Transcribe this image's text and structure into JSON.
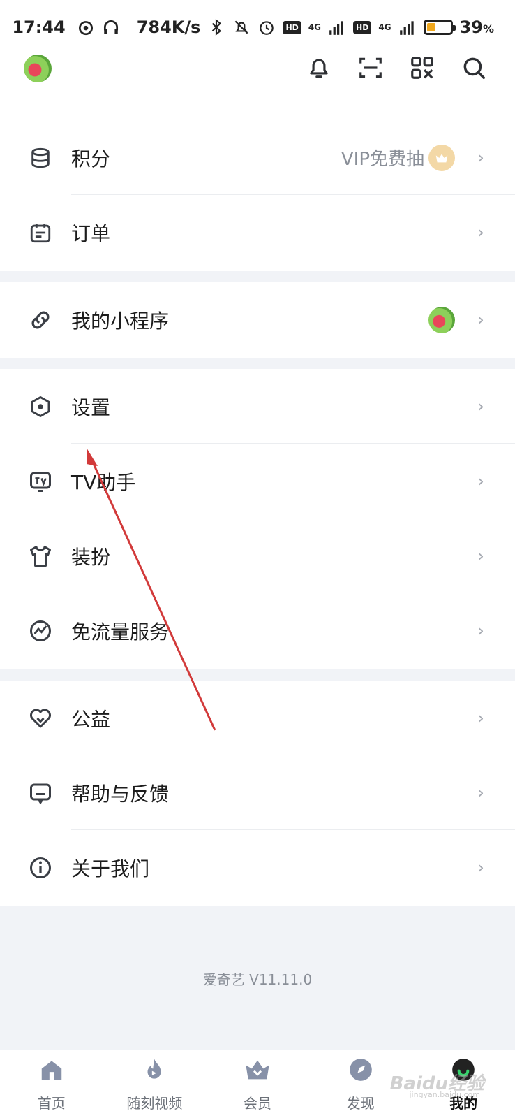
{
  "status_bar": {
    "time": "17:44",
    "speed": "784K/s",
    "battery": "39",
    "battery_unit": "%",
    "hd1": "HD",
    "hd2": "HD",
    "sig1": "4G",
    "sig2": "4G"
  },
  "header": {
    "icons": [
      "bell-icon",
      "scan-icon",
      "qrcode-icon",
      "search-icon"
    ]
  },
  "menu_groups": [
    {
      "items": [
        {
          "label": "积分",
          "icon": "coins-icon",
          "extra": "VIP免费抽"
        },
        {
          "label": "订单",
          "icon": "order-icon"
        }
      ]
    },
    {
      "items": [
        {
          "label": "我的小程序",
          "icon": "link-icon"
        }
      ]
    },
    {
      "items": [
        {
          "label": "设置",
          "icon": "settings-icon"
        },
        {
          "label": "TV助手",
          "icon": "tv-icon"
        },
        {
          "label": "装扮",
          "icon": "shirt-icon"
        },
        {
          "label": "免流量服务",
          "icon": "data-icon"
        }
      ]
    },
    {
      "items": [
        {
          "label": "公益",
          "icon": "heart-icon"
        },
        {
          "label": "帮助与反馈",
          "icon": "feedback-icon"
        },
        {
          "label": "关于我们",
          "icon": "info-icon"
        }
      ]
    }
  ],
  "version": "爱奇艺 V11.11.0",
  "bottom_nav": [
    {
      "label": "首页",
      "icon": "home-icon"
    },
    {
      "label": "随刻视频",
      "icon": "flame-icon"
    },
    {
      "label": "会员",
      "icon": "crown-icon"
    },
    {
      "label": "发现",
      "icon": "compass-icon"
    },
    {
      "label": "我的",
      "icon": "profile-icon",
      "active": true
    }
  ],
  "watermark": {
    "text": "Baidu经验",
    "sub": "jingyan.baidu.com"
  },
  "colors": {
    "accent": "#c62828",
    "background": "#f1f3f7",
    "icon": "#3b3f46"
  }
}
